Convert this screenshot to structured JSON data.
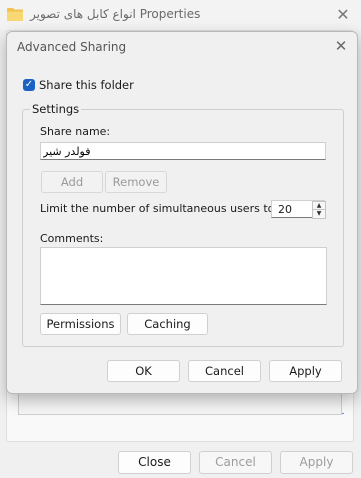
{
  "background_window": {
    "title": "انواع کابل های تصویر Properties",
    "buttons": {
      "close": "Close",
      "cancel": "Cancel",
      "apply": "Apply"
    }
  },
  "dialog": {
    "title": "Advanced Sharing",
    "share_checkbox": {
      "label": "Share this folder",
      "checked": true
    },
    "settings": {
      "legend": "Settings",
      "share_name_label": "Share name:",
      "share_name_value": "فولدر شیر",
      "add_label": "Add",
      "remove_label": "Remove",
      "limit_label": "Limit the number of simultaneous users to:",
      "limit_value": "20",
      "comments_label": "Comments:",
      "comments_value": "",
      "permissions_label": "Permissions",
      "caching_label": "Caching"
    },
    "buttons": {
      "ok": "OK",
      "cancel": "Cancel",
      "apply": "Apply"
    }
  },
  "colors": {
    "accent": "#1a63c5",
    "window_bg": "#f0f0f0"
  }
}
